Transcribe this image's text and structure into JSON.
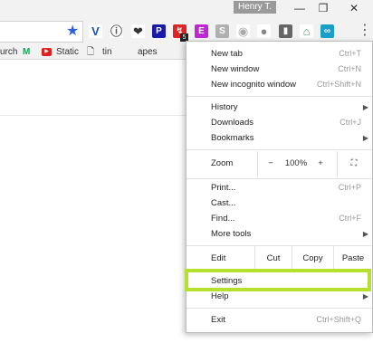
{
  "window": {
    "profile_name": "Henry T.",
    "minimize_glyph": "—",
    "restore_glyph": "❐",
    "close_glyph": "✕"
  },
  "toolbar": {
    "star_icon": "star-icon",
    "star_glyph": "★",
    "menu_glyph": "⋮",
    "extensions": [
      {
        "name": "vimium-extension-icon",
        "glyph": "V",
        "bg": "#ffffff",
        "fg": "#1b4fb8"
      },
      {
        "name": "info-extension-icon",
        "glyph": "ⓘ",
        "bg": "#ffffff",
        "fg": "#555555"
      },
      {
        "name": "pocket-extension-icon",
        "glyph": "❤",
        "bg": "#ffffff",
        "fg": "#333333"
      },
      {
        "name": "parking-extension-icon",
        "glyph": "P",
        "bg": "#1a1aaa",
        "fg": "#ffffff"
      },
      {
        "name": "redirect-extension-icon",
        "glyph": "↯",
        "bg": "#e02424",
        "fg": "#ffffff"
      },
      {
        "name": "color-e-extension-icon",
        "glyph": "E",
        "bg": "#c026d3",
        "fg": "#ffffff"
      },
      {
        "name": "s-extension-icon",
        "glyph": "S",
        "bg": "#b0b0b0",
        "fg": "#ffffff"
      },
      {
        "name": "camera-extension-icon",
        "glyph": "◉",
        "bg": "#ffffff",
        "fg": "#aaaaaa"
      },
      {
        "name": "speech-extension-icon",
        "glyph": "●",
        "bg": "#ffffff",
        "fg": "#888888"
      },
      {
        "name": "door-extension-icon",
        "glyph": "▮",
        "bg": "#666666",
        "fg": "#ffffff"
      },
      {
        "name": "android-extension-icon",
        "glyph": "⌂",
        "bg": "#ffffff",
        "fg": "#2eaa5a"
      },
      {
        "name": "link-extension-icon",
        "glyph": "∞",
        "bg": "#1aa0c8",
        "fg": "#ffffff"
      }
    ],
    "badge": "5"
  },
  "bookmarks": {
    "items": [
      {
        "name": "bookmark-search",
        "label": "urch",
        "icon": ""
      },
      {
        "name": "bookmark-m",
        "label": "",
        "icon": "M"
      },
      {
        "name": "bookmark-static",
        "label": "Static",
        "icon": "▶"
      },
      {
        "name": "bookmark-tiny",
        "label": "tin",
        "icon": "🗋"
      },
      {
        "name": "bookmark-apes",
        "label": "apes",
        "icon": ""
      }
    ]
  },
  "menu": {
    "new_tab": {
      "label": "New tab",
      "shortcut": "Ctrl+T"
    },
    "new_window": {
      "label": "New window",
      "shortcut": "Ctrl+N"
    },
    "new_incognito": {
      "label": "New incognito window",
      "shortcut": "Ctrl+Shift+N"
    },
    "history": {
      "label": "History",
      "arrow": "▶"
    },
    "downloads": {
      "label": "Downloads",
      "shortcut": "Ctrl+J"
    },
    "bookmarks": {
      "label": "Bookmarks",
      "arrow": "▶"
    },
    "zoom": {
      "label": "Zoom",
      "minus": "−",
      "level": "100%",
      "plus": "+",
      "fullscreen": "⛶"
    },
    "print": {
      "label": "Print...",
      "shortcut": "Ctrl+P"
    },
    "cast": {
      "label": "Cast..."
    },
    "find": {
      "label": "Find...",
      "shortcut": "Ctrl+F"
    },
    "more_tools": {
      "label": "More tools",
      "arrow": "▶"
    },
    "edit": {
      "label": "Edit",
      "cut": "Cut",
      "copy": "Copy",
      "paste": "Paste"
    },
    "settings": {
      "label": "Settings"
    },
    "help": {
      "label": "Help",
      "arrow": "▶"
    },
    "exit": {
      "label": "Exit",
      "shortcut": "Ctrl+Shift+Q"
    }
  },
  "colors": {
    "highlight": "#b6e02e",
    "accent": "#2b62d6"
  }
}
